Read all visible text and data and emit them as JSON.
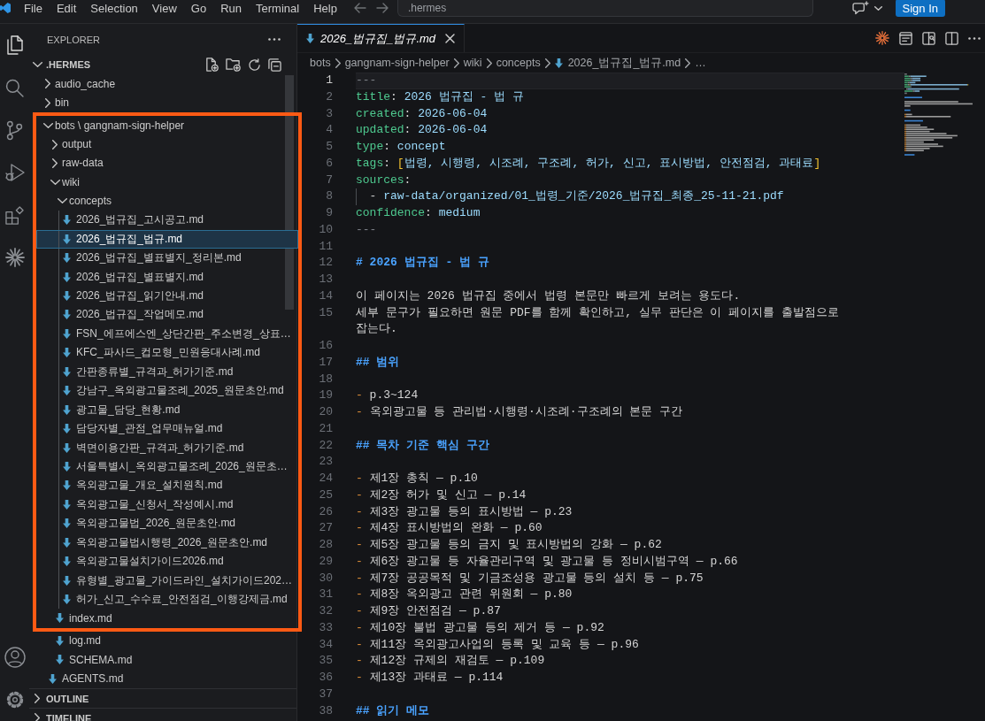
{
  "title_bar": {
    "menus": [
      "File",
      "Edit",
      "Selection",
      "View",
      "Go",
      "Run",
      "Terminal",
      "Help"
    ],
    "command_center": {
      "label": ".hermes"
    },
    "sign_in": "Sign In"
  },
  "activity_bar": {
    "items": [
      {
        "kind": "explorer",
        "selected": true
      },
      {
        "kind": "search",
        "selected": false
      },
      {
        "kind": "source_control",
        "selected": false
      },
      {
        "kind": "run_debug",
        "selected": false
      },
      {
        "kind": "extensions",
        "selected": false
      },
      {
        "kind": "agent",
        "selected": false
      }
    ],
    "bottom": [
      {
        "kind": "accounts"
      },
      {
        "kind": "settings"
      }
    ]
  },
  "explorer": {
    "title": "EXPLORER",
    "workspace": {
      "name": ".HERMES",
      "expanded": true
    },
    "tree": [
      {
        "name": "audio_cache",
        "kind": "folder",
        "expanded": false,
        "selected": false,
        "framed": false
      },
      {
        "name": "bin",
        "kind": "folder",
        "expanded": false,
        "selected": false,
        "framed": false
      },
      {
        "name": "bots \\ gangnam-sign-helper",
        "kind": "folder",
        "expanded": true,
        "selected": false,
        "framed": true,
        "children": [
          {
            "name": "output",
            "kind": "folder",
            "expanded": false,
            "selected": false,
            "framed": true
          },
          {
            "name": "raw-data",
            "kind": "folder",
            "expanded": false,
            "selected": false,
            "framed": true
          },
          {
            "name": "wiki",
            "kind": "folder",
            "expanded": true,
            "selected": false,
            "framed": true,
            "children": [
              {
                "name": "concepts",
                "kind": "folder",
                "expanded": true,
                "selected": false,
                "framed": true,
                "children": [
                  {
                    "name": "2026_법규집_고시공고.md",
                    "kind": "file",
                    "selected": false,
                    "framed": true
                  },
                  {
                    "name": "2026_법규집_법규.md",
                    "kind": "file",
                    "selected": true,
                    "framed": true
                  },
                  {
                    "name": "2026_법규집_별표별지_정리본.md",
                    "kind": "file",
                    "selected": false,
                    "framed": true
                  },
                  {
                    "name": "2026_법규집_별표별지.md",
                    "kind": "file",
                    "selected": false,
                    "framed": true
                  },
                  {
                    "name": "2026_법규집_읽기안내.md",
                    "kind": "file",
                    "selected": false,
                    "framed": true
                  },
                  {
                    "name": "2026_법규집_작업메모.md",
                    "kind": "file",
                    "selected": false,
                    "framed": true
                  },
                  {
                    "name": "FSN_에프에스엔_상단간판_주소변경_상표…",
                    "kind": "file",
                    "selected": false,
                    "framed": true
                  },
                  {
                    "name": "KFC_파사드_컵모형_민원응대사례.md",
                    "kind": "file",
                    "selected": false,
                    "framed": true
                  },
                  {
                    "name": "간판종류별_규격과_허가기준.md",
                    "kind": "file",
                    "selected": false,
                    "framed": true
                  },
                  {
                    "name": "강남구_옥외광고물조례_2025_원문초안.md",
                    "kind": "file",
                    "selected": false,
                    "framed": true
                  },
                  {
                    "name": "광고물_담당_현황.md",
                    "kind": "file",
                    "selected": false,
                    "framed": true
                  },
                  {
                    "name": "담당자별_관점_업무매뉴얼.md",
                    "kind": "file",
                    "selected": false,
                    "framed": true
                  },
                  {
                    "name": "벽면이용간판_규격과_허가기준.md",
                    "kind": "file",
                    "selected": false,
                    "framed": true
                  },
                  {
                    "name": "서울특별시_옥외광고물조례_2026_원문초…",
                    "kind": "file",
                    "selected": false,
                    "framed": true
                  },
                  {
                    "name": "옥외광고물_개요_설치원칙.md",
                    "kind": "file",
                    "selected": false,
                    "framed": true
                  },
                  {
                    "name": "옥외광고물_신청서_작성예시.md",
                    "kind": "file",
                    "selected": false,
                    "framed": true
                  },
                  {
                    "name": "옥외광고물법_2026_원문초안.md",
                    "kind": "file",
                    "selected": false,
                    "framed": true
                  },
                  {
                    "name": "옥외광고물법시행령_2026_원문초안.md",
                    "kind": "file",
                    "selected": false,
                    "framed": true
                  },
                  {
                    "name": "옥외광고물설치가이드2026.md",
                    "kind": "file",
                    "selected": false,
                    "framed": true
                  },
                  {
                    "name": "유형별_광고물_가이드라인_설치가이드202…",
                    "kind": "file",
                    "selected": false,
                    "framed": true
                  },
                  {
                    "name": "허가_신고_수수료_안전점검_이행강제금.md",
                    "kind": "file",
                    "selected": false,
                    "framed": true
                  }
                ]
              },
              {
                "name": "index.md",
                "kind": "file",
                "selected": false,
                "framed": true
              },
              {
                "name": "log.md",
                "kind": "file",
                "selected": false,
                "framed": false
              },
              {
                "name": "SCHEMA.md",
                "kind": "file",
                "selected": false,
                "framed": false
              }
            ]
          },
          {
            "name": "AGENTS.md",
            "kind": "file",
            "selected": false,
            "framed": false
          }
        ]
      }
    ],
    "sections": [
      {
        "title": "OUTLINE",
        "expanded": false
      },
      {
        "title": "TIMELINE",
        "expanded": false
      }
    ]
  },
  "editor": {
    "tabs": [
      {
        "label": "2026_법규집_법규.md",
        "selected": true,
        "preview": true
      }
    ],
    "breadcrumbs": [
      {
        "label": "bots",
        "kind": "folder"
      },
      {
        "label": "gangnam-sign-helper",
        "kind": "folder"
      },
      {
        "label": "wiki",
        "kind": "folder"
      },
      {
        "label": "concepts",
        "kind": "folder"
      },
      {
        "label": "2026_법규집_법규.md",
        "kind": "file"
      },
      {
        "label": "…",
        "kind": "symbol"
      }
    ],
    "lines": [
      {
        "number": "1",
        "active": true,
        "tokens": [
          {
            "kind": "fence",
            "text": "---"
          }
        ]
      },
      {
        "number": "2",
        "active": false,
        "tokens": [
          {
            "kind": "key",
            "text": "title"
          },
          {
            "kind": "punct",
            "text": ": "
          },
          {
            "kind": "value",
            "text": "2026 법규집 - 법 규"
          }
        ]
      },
      {
        "number": "3",
        "active": false,
        "tokens": [
          {
            "kind": "key",
            "text": "created"
          },
          {
            "kind": "punct",
            "text": ": "
          },
          {
            "kind": "value",
            "text": "2026-06-04"
          }
        ]
      },
      {
        "number": "4",
        "active": false,
        "tokens": [
          {
            "kind": "key",
            "text": "updated"
          },
          {
            "kind": "punct",
            "text": ": "
          },
          {
            "kind": "value",
            "text": "2026-06-04"
          }
        ]
      },
      {
        "number": "5",
        "active": false,
        "tokens": [
          {
            "kind": "key",
            "text": "type"
          },
          {
            "kind": "punct",
            "text": ": "
          },
          {
            "kind": "value",
            "text": "concept"
          }
        ]
      },
      {
        "number": "6",
        "active": false,
        "tokens": [
          {
            "kind": "key",
            "text": "tags"
          },
          {
            "kind": "punct",
            "text": ": "
          },
          {
            "kind": "bracket",
            "text": "["
          },
          {
            "kind": "value",
            "text": "법령, 시행령, 시조례, 구조례, 허가, 신고, 표시방법, 안전점검, 과태료"
          },
          {
            "kind": "bracket",
            "text": "]"
          }
        ]
      },
      {
        "number": "7",
        "active": false,
        "tokens": [
          {
            "kind": "key",
            "text": "sources"
          },
          {
            "kind": "punct",
            "text": ":"
          }
        ]
      },
      {
        "number": "8",
        "active": false,
        "tokens": [
          {
            "kind": "indent"
          },
          {
            "kind": "punct",
            "text": "- "
          },
          {
            "kind": "value",
            "text": "raw-data/organized/01_법령_기준/2026_법규집_최종_25-11-21.pdf"
          }
        ]
      },
      {
        "number": "9",
        "active": false,
        "tokens": [
          {
            "kind": "key",
            "text": "confidence"
          },
          {
            "kind": "punct",
            "text": ": "
          },
          {
            "kind": "value",
            "text": "medium"
          }
        ]
      },
      {
        "number": "10",
        "active": false,
        "tokens": [
          {
            "kind": "fence",
            "text": "---"
          }
        ]
      },
      {
        "number": "11",
        "active": false
      },
      {
        "number": "12",
        "active": false,
        "tokens": [
          {
            "kind": "heading",
            "text": "# 2026 법규집 - 법 규"
          }
        ]
      },
      {
        "number": "13",
        "active": false
      },
      {
        "number": "14",
        "active": false,
        "tokens": [
          {
            "kind": "text",
            "text": "이 페이지는 2026 법규집 중에서 법령 본문만 빠르게 보려는 용도다."
          }
        ]
      },
      {
        "number": "15",
        "active": false,
        "tokens": [
          {
            "kind": "text",
            "text": "세부 문구가 필요하면 원문 PDF를 함께 확인하고, 실무 판단은 이 페이지를 출발점으로"
          }
        ],
        "continuation": [
          {
            "kind": "text",
            "text": "잡는다."
          }
        ]
      },
      {
        "number": "16",
        "active": false
      },
      {
        "number": "17",
        "active": false,
        "tokens": [
          {
            "kind": "heading",
            "text": "## 범위"
          }
        ]
      },
      {
        "number": "18",
        "active": false
      },
      {
        "number": "19",
        "active": false,
        "tokens": [
          {
            "kind": "bullet",
            "text": "- "
          },
          {
            "kind": "text",
            "text": "p.3~124"
          }
        ]
      },
      {
        "number": "20",
        "active": false,
        "tokens": [
          {
            "kind": "bullet",
            "text": "- "
          },
          {
            "kind": "text",
            "text": "옥외광고물 등 관리법·시행령·시조례·구조례의 본문 구간"
          }
        ]
      },
      {
        "number": "21",
        "active": false
      },
      {
        "number": "22",
        "active": false,
        "tokens": [
          {
            "kind": "heading",
            "text": "## 목차 기준 핵심 구간"
          }
        ]
      },
      {
        "number": "23",
        "active": false
      },
      {
        "number": "24",
        "active": false,
        "tokens": [
          {
            "kind": "bullet",
            "text": "- "
          },
          {
            "kind": "text",
            "text": "제1장 총칙 — p.10"
          }
        ]
      },
      {
        "number": "25",
        "active": false,
        "tokens": [
          {
            "kind": "bullet",
            "text": "- "
          },
          {
            "kind": "text",
            "text": "제2장 허가 및 신고 — p.14"
          }
        ]
      },
      {
        "number": "26",
        "active": false,
        "tokens": [
          {
            "kind": "bullet",
            "text": "- "
          },
          {
            "kind": "text",
            "text": "제3장 광고물 등의 표시방법 — p.23"
          }
        ]
      },
      {
        "number": "27",
        "active": false,
        "tokens": [
          {
            "kind": "bullet",
            "text": "- "
          },
          {
            "kind": "text",
            "text": "제4장 표시방법의 완화 — p.60"
          }
        ]
      },
      {
        "number": "28",
        "active": false,
        "tokens": [
          {
            "kind": "bullet",
            "text": "- "
          },
          {
            "kind": "text",
            "text": "제5장 광고물 등의 금지 및 표시방법의 강화 — p.62"
          }
        ]
      },
      {
        "number": "29",
        "active": false,
        "tokens": [
          {
            "kind": "bullet",
            "text": "- "
          },
          {
            "kind": "text",
            "text": "제6장 광고물 등 자율관리구역 및 광고물 등 정비시범구역 — p.66"
          }
        ]
      },
      {
        "number": "30",
        "active": false,
        "tokens": [
          {
            "kind": "bullet",
            "text": "- "
          },
          {
            "kind": "text",
            "text": "제7장 공공목적 및 기금조성용 광고물 등의 설치 등 — p.75"
          }
        ]
      },
      {
        "number": "31",
        "active": false,
        "tokens": [
          {
            "kind": "bullet",
            "text": "- "
          },
          {
            "kind": "text",
            "text": "제8장 옥외광고 관련 위원회 — p.80"
          }
        ]
      },
      {
        "number": "32",
        "active": false,
        "tokens": [
          {
            "kind": "bullet",
            "text": "- "
          },
          {
            "kind": "text",
            "text": "제9장 안전점검 — p.87"
          }
        ]
      },
      {
        "number": "33",
        "active": false,
        "tokens": [
          {
            "kind": "bullet",
            "text": "- "
          },
          {
            "kind": "text",
            "text": "제10장 불법 광고물 등의 제거 등 — p.92"
          }
        ]
      },
      {
        "number": "34",
        "active": false,
        "tokens": [
          {
            "kind": "bullet",
            "text": "- "
          },
          {
            "kind": "text",
            "text": "제11장 옥외광고사업의 등록 및 교육 등 — p.96"
          }
        ]
      },
      {
        "number": "35",
        "active": false,
        "tokens": [
          {
            "kind": "bullet",
            "text": "- "
          },
          {
            "kind": "text",
            "text": "제12장 규제의 재검토 — p.109"
          }
        ]
      },
      {
        "number": "36",
        "active": false,
        "tokens": [
          {
            "kind": "bullet",
            "text": "- "
          },
          {
            "kind": "text",
            "text": "제13장 과태료 — p.114"
          }
        ]
      },
      {
        "number": "37",
        "active": false
      },
      {
        "number": "38",
        "active": false,
        "tokens": [
          {
            "kind": "heading",
            "text": "## 읽기 메모"
          }
        ]
      }
    ]
  },
  "annotation": {
    "kind": "frame"
  }
}
